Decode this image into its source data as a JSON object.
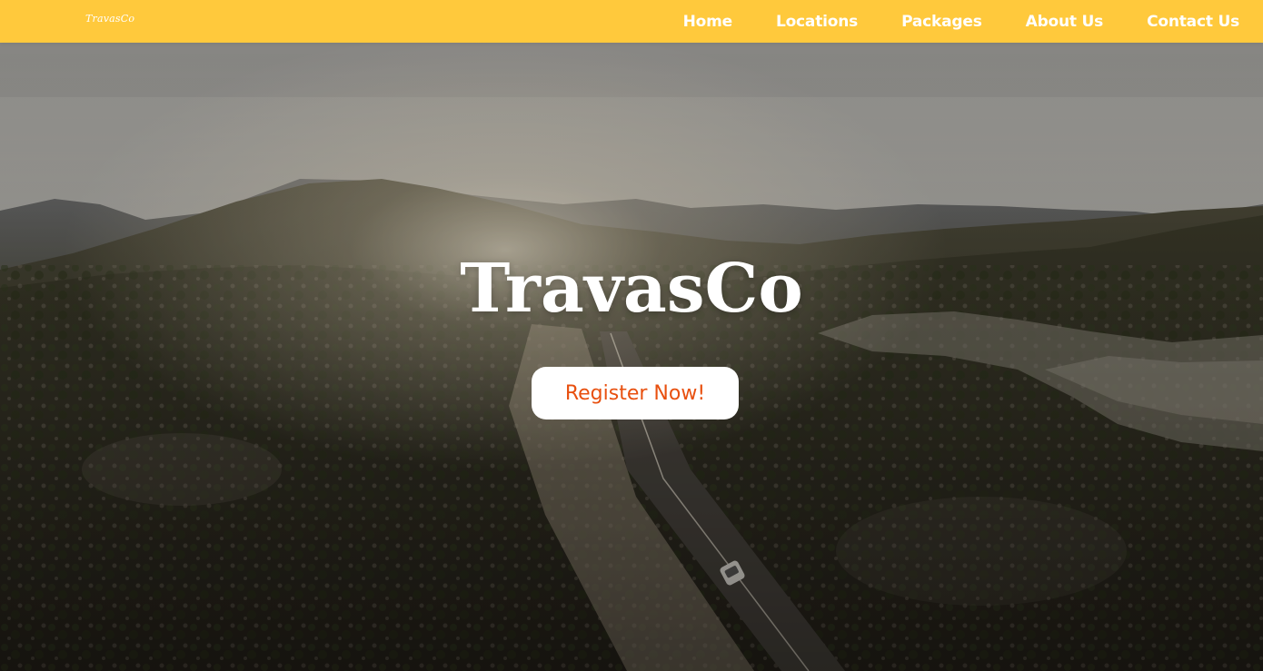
{
  "brand": {
    "name": "TravasCo"
  },
  "nav": {
    "items": [
      {
        "label": "Home"
      },
      {
        "label": "Locations"
      },
      {
        "label": "Packages"
      },
      {
        "label": "About Us"
      },
      {
        "label": "Contact Us"
      }
    ]
  },
  "hero": {
    "title": "TravasCo",
    "cta_label": "Register Now!",
    "background": "aerial-landscape-road-image"
  },
  "colors": {
    "navbar": "#ffc93c",
    "cta_text": "#e8500f",
    "cta_background": "#ffffff",
    "nav_text": "#ffffff"
  }
}
